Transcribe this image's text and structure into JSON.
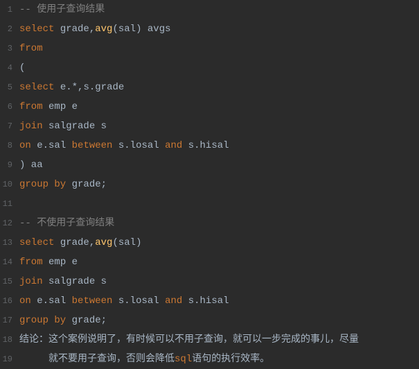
{
  "lines": [
    {
      "num": "1",
      "tokens": [
        {
          "cls": "tok-comment",
          "t": "-- 使用子查询结果"
        }
      ]
    },
    {
      "num": "2",
      "tokens": [
        {
          "cls": "tok-keyword",
          "t": "select"
        },
        {
          "cls": "tok-ident",
          "t": " grade"
        },
        {
          "cls": "tok-punct",
          "t": ","
        },
        {
          "cls": "tok-func",
          "t": "avg"
        },
        {
          "cls": "tok-punct",
          "t": "("
        },
        {
          "cls": "tok-ident",
          "t": "sal"
        },
        {
          "cls": "tok-punct",
          "t": ")"
        },
        {
          "cls": "tok-ident",
          "t": " avgs"
        }
      ]
    },
    {
      "num": "3",
      "tokens": [
        {
          "cls": "tok-keyword",
          "t": "from"
        }
      ]
    },
    {
      "num": "4",
      "tokens": [
        {
          "cls": "tok-punct",
          "t": "("
        }
      ]
    },
    {
      "num": "5",
      "tokens": [
        {
          "cls": "tok-keyword",
          "t": "select"
        },
        {
          "cls": "tok-ident",
          "t": " e"
        },
        {
          "cls": "tok-punct",
          "t": "."
        },
        {
          "cls": "tok-punct",
          "t": "*"
        },
        {
          "cls": "tok-punct",
          "t": ","
        },
        {
          "cls": "tok-ident",
          "t": "s"
        },
        {
          "cls": "tok-punct",
          "t": "."
        },
        {
          "cls": "tok-ident",
          "t": "grade"
        }
      ]
    },
    {
      "num": "6",
      "tokens": [
        {
          "cls": "tok-keyword",
          "t": "from"
        },
        {
          "cls": "tok-ident",
          "t": " emp e"
        }
      ]
    },
    {
      "num": "7",
      "tokens": [
        {
          "cls": "tok-keyword",
          "t": "join"
        },
        {
          "cls": "tok-ident",
          "t": " salgrade s"
        }
      ]
    },
    {
      "num": "8",
      "tokens": [
        {
          "cls": "tok-keyword",
          "t": "on"
        },
        {
          "cls": "tok-ident",
          "t": " e"
        },
        {
          "cls": "tok-punct",
          "t": "."
        },
        {
          "cls": "tok-ident",
          "t": "sal "
        },
        {
          "cls": "tok-keyword",
          "t": "between"
        },
        {
          "cls": "tok-ident",
          "t": " s"
        },
        {
          "cls": "tok-punct",
          "t": "."
        },
        {
          "cls": "tok-ident",
          "t": "losal "
        },
        {
          "cls": "tok-keyword",
          "t": "and"
        },
        {
          "cls": "tok-ident",
          "t": " s"
        },
        {
          "cls": "tok-punct",
          "t": "."
        },
        {
          "cls": "tok-ident",
          "t": "hisal"
        }
      ]
    },
    {
      "num": "9",
      "tokens": [
        {
          "cls": "tok-punct",
          "t": ")"
        },
        {
          "cls": "tok-ident",
          "t": " aa"
        }
      ]
    },
    {
      "num": "10",
      "tokens": [
        {
          "cls": "tok-keyword",
          "t": "group by"
        },
        {
          "cls": "tok-ident",
          "t": " grade"
        },
        {
          "cls": "tok-punct",
          "t": ";"
        }
      ]
    },
    {
      "num": "11",
      "tokens": []
    },
    {
      "num": "12",
      "tokens": [
        {
          "cls": "tok-comment",
          "t": "-- 不使用子查询结果"
        }
      ]
    },
    {
      "num": "13",
      "tokens": [
        {
          "cls": "tok-keyword",
          "t": "select"
        },
        {
          "cls": "tok-ident",
          "t": " grade"
        },
        {
          "cls": "tok-punct",
          "t": ","
        },
        {
          "cls": "tok-func",
          "t": "avg"
        },
        {
          "cls": "tok-punct",
          "t": "("
        },
        {
          "cls": "tok-ident",
          "t": "sal"
        },
        {
          "cls": "tok-punct",
          "t": ")"
        }
      ]
    },
    {
      "num": "14",
      "tokens": [
        {
          "cls": "tok-keyword",
          "t": "from"
        },
        {
          "cls": "tok-ident",
          "t": " emp e"
        }
      ]
    },
    {
      "num": "15",
      "tokens": [
        {
          "cls": "tok-keyword",
          "t": "join"
        },
        {
          "cls": "tok-ident",
          "t": " salgrade s"
        }
      ]
    },
    {
      "num": "16",
      "tokens": [
        {
          "cls": "tok-keyword",
          "t": "on"
        },
        {
          "cls": "tok-ident",
          "t": " e"
        },
        {
          "cls": "tok-punct",
          "t": "."
        },
        {
          "cls": "tok-ident",
          "t": "sal "
        },
        {
          "cls": "tok-keyword",
          "t": "between"
        },
        {
          "cls": "tok-ident",
          "t": " s"
        },
        {
          "cls": "tok-punct",
          "t": "."
        },
        {
          "cls": "tok-ident",
          "t": "losal "
        },
        {
          "cls": "tok-keyword",
          "t": "and"
        },
        {
          "cls": "tok-ident",
          "t": " s"
        },
        {
          "cls": "tok-punct",
          "t": "."
        },
        {
          "cls": "tok-ident",
          "t": "hisal"
        }
      ]
    },
    {
      "num": "17",
      "tokens": [
        {
          "cls": "tok-keyword",
          "t": "group by"
        },
        {
          "cls": "tok-ident",
          "t": " grade"
        },
        {
          "cls": "tok-punct",
          "t": ";"
        }
      ]
    },
    {
      "num": "18",
      "tokens": [
        {
          "cls": "tok-plain",
          "t": "结论：这个案例说明了，有时候可以不用子查询，就可以一步完成的事儿，尽量"
        }
      ]
    },
    {
      "num": "19",
      "tokens": [
        {
          "cls": "tok-plain",
          "t": "     就不要用子查询，否则会降低"
        },
        {
          "cls": "tok-sql",
          "t": "sql"
        },
        {
          "cls": "tok-plain",
          "t": "语句的执行效率。"
        }
      ]
    }
  ]
}
